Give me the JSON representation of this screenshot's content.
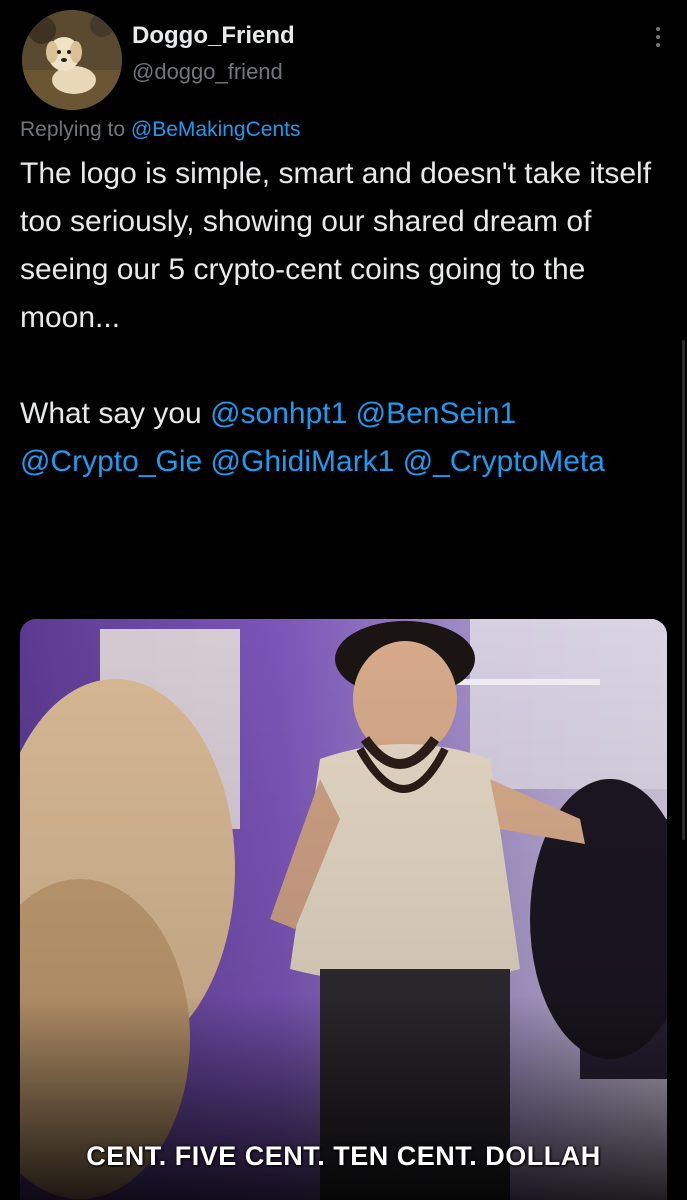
{
  "author": {
    "display_name": "Doggo_Friend",
    "handle": "@doggo_friend",
    "avatar_icon": "dog-avatar"
  },
  "reply": {
    "prefix": "Replying to",
    "mention": "@BeMakingCents"
  },
  "tweet": {
    "body": "The logo is simple, smart and doesn't take itself too seriously, showing our shared dream of seeing our 5 crypto-cent coins going to the moon...",
    "question": "What say you",
    "mentions": [
      "@sonhpt1",
      "@BenSein1",
      "@Crypto_Gie",
      "@GhidiMark1",
      "@_CryptoMeta"
    ]
  },
  "media": {
    "caption": "CENT. FIVE CENT. TEN CENT. DOLLAH"
  },
  "colors": {
    "background": "#000000",
    "text": "#e7e9ea",
    "muted": "#71767b",
    "link": "#1d9bf0"
  }
}
